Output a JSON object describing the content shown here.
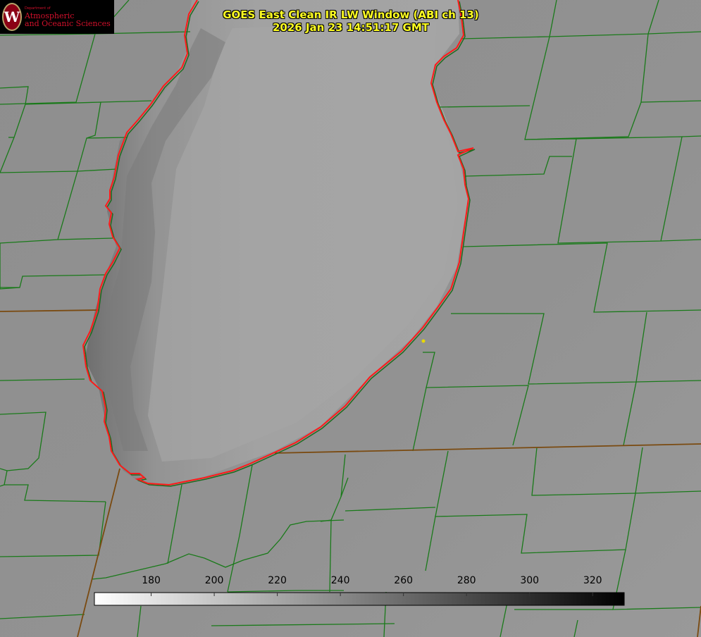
{
  "title": {
    "line1": "GOES East Clean IR LW Window (ABI ch 13)",
    "line2": "2026 Jan 23 14:51:17 GMT"
  },
  "logo": {
    "crest_letter": "W",
    "dept": "Department of",
    "line1": "Atmospheric",
    "line2": "and Oceanic Sciences"
  },
  "colorbar": {
    "ticks": [
      "180",
      "200",
      "220",
      "240",
      "260",
      "280",
      "300",
      "320"
    ],
    "tick_values": [
      180,
      200,
      220,
      240,
      260,
      280,
      300,
      320
    ],
    "range": [
      162,
      330
    ],
    "gradient": [
      "#ffffff",
      "#000000"
    ]
  },
  "colors": {
    "land": "#8f8f8f",
    "lake": "#a2a2a2",
    "county_lines": "#1a7a1a",
    "shoreline": "#ff1a1a",
    "state_lines": "#7a4a10",
    "title_text": "#ffff22",
    "marker": "#e8d800"
  }
}
